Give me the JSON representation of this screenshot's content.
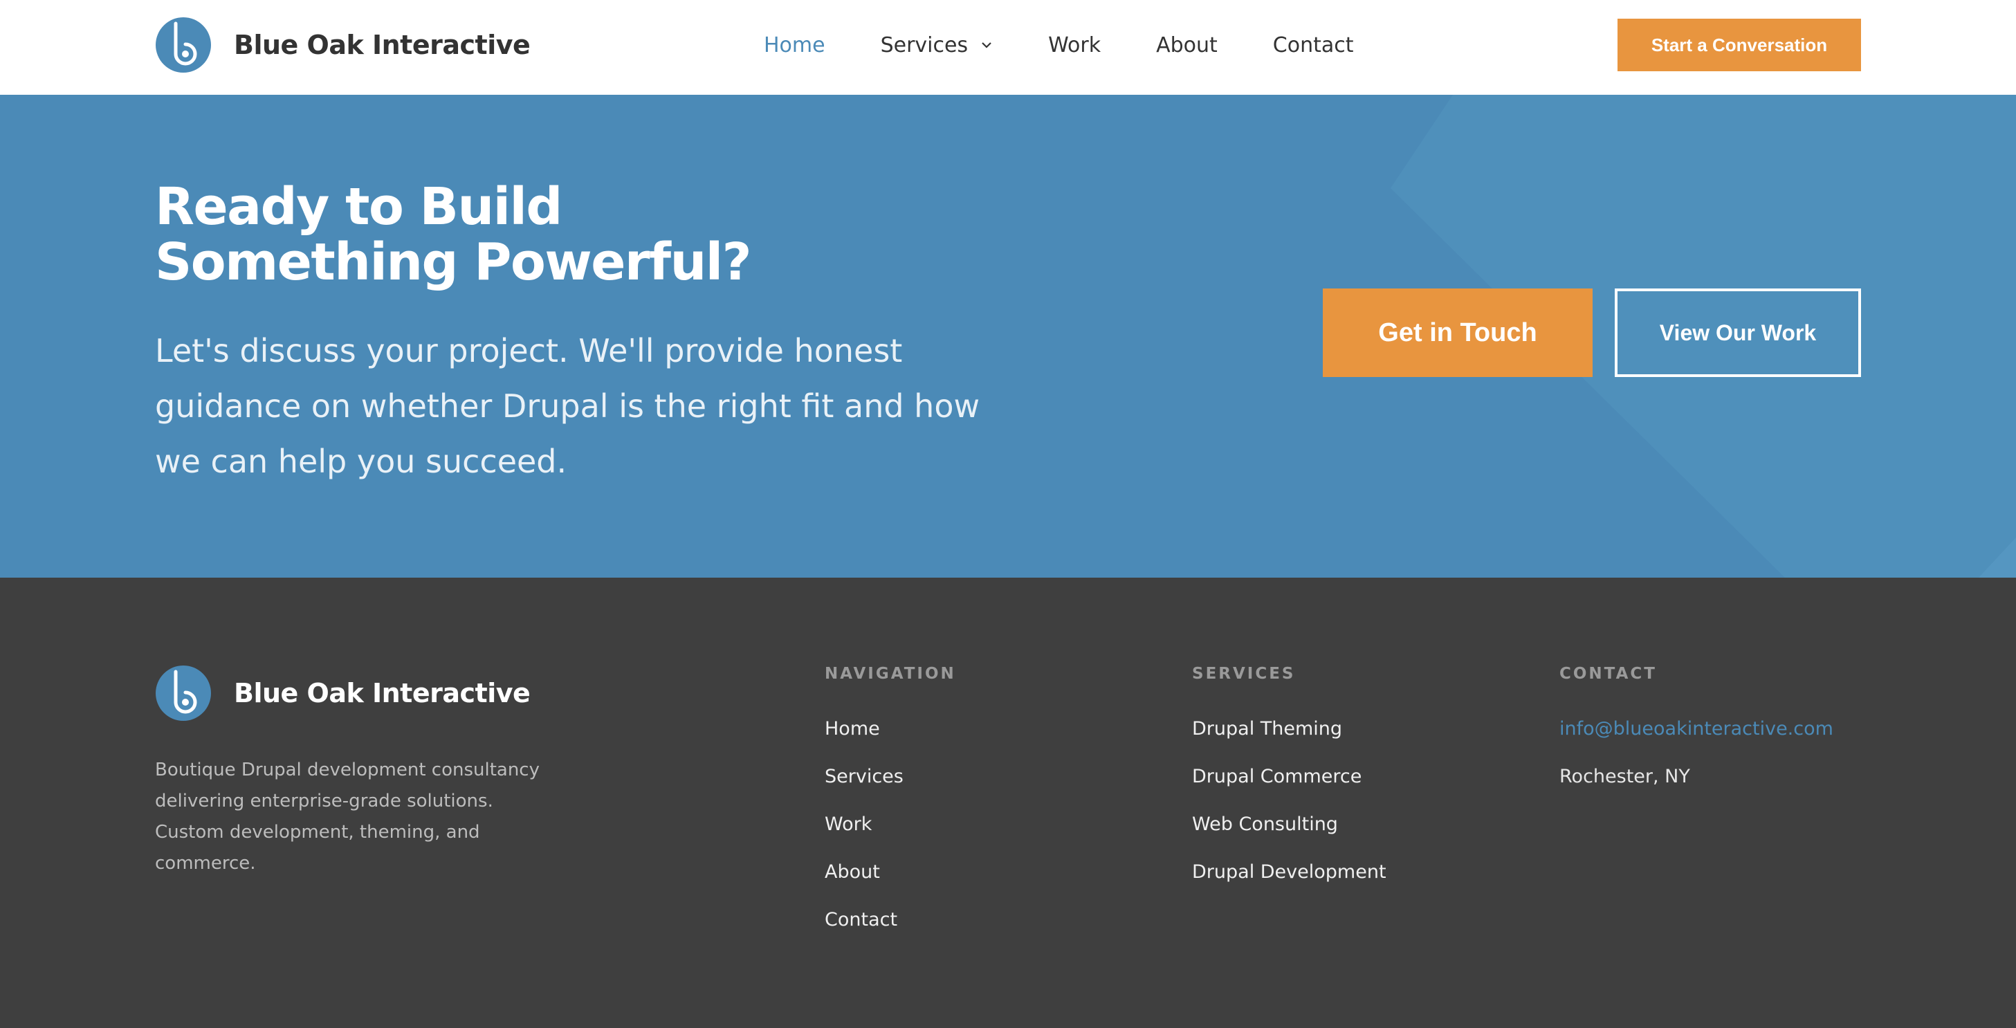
{
  "brand": {
    "name": "Blue Oak Interactive",
    "logo_icon": "blue-oak-b-icon",
    "primary_color": "#4b8ab7",
    "accent_color": "#e8953f",
    "dark_color": "#3f3f3f"
  },
  "header": {
    "nav": [
      {
        "label": "Home",
        "active": true
      },
      {
        "label": "Services",
        "dropdown": true
      },
      {
        "label": "Work"
      },
      {
        "label": "About"
      },
      {
        "label": "Contact"
      }
    ],
    "cta_label": "Start a Conversation"
  },
  "hero": {
    "title": "Ready to Build Something Powerful?",
    "subtitle": "Let's discuss your project. We'll provide honest guidance on whether Drupal is the right fit and how we can help you succeed.",
    "primary_button": "Get in Touch",
    "secondary_button": "View Our Work"
  },
  "footer": {
    "brand_name": "Blue Oak Interactive",
    "description": "Boutique Drupal development consultancy delivering enterprise-grade solutions. Custom development, theming, and commerce.",
    "navigation": {
      "heading": "NAVIGATION",
      "links": [
        "Home",
        "Services",
        "Work",
        "About",
        "Contact"
      ]
    },
    "services": {
      "heading": "SERVICES",
      "links": [
        "Drupal Theming",
        "Drupal Commerce",
        "Web Consulting",
        "Drupal Development"
      ]
    },
    "contact": {
      "heading": "CONTACT",
      "email": "info@blueoakinteractive.com",
      "location": "Rochester, NY"
    }
  }
}
